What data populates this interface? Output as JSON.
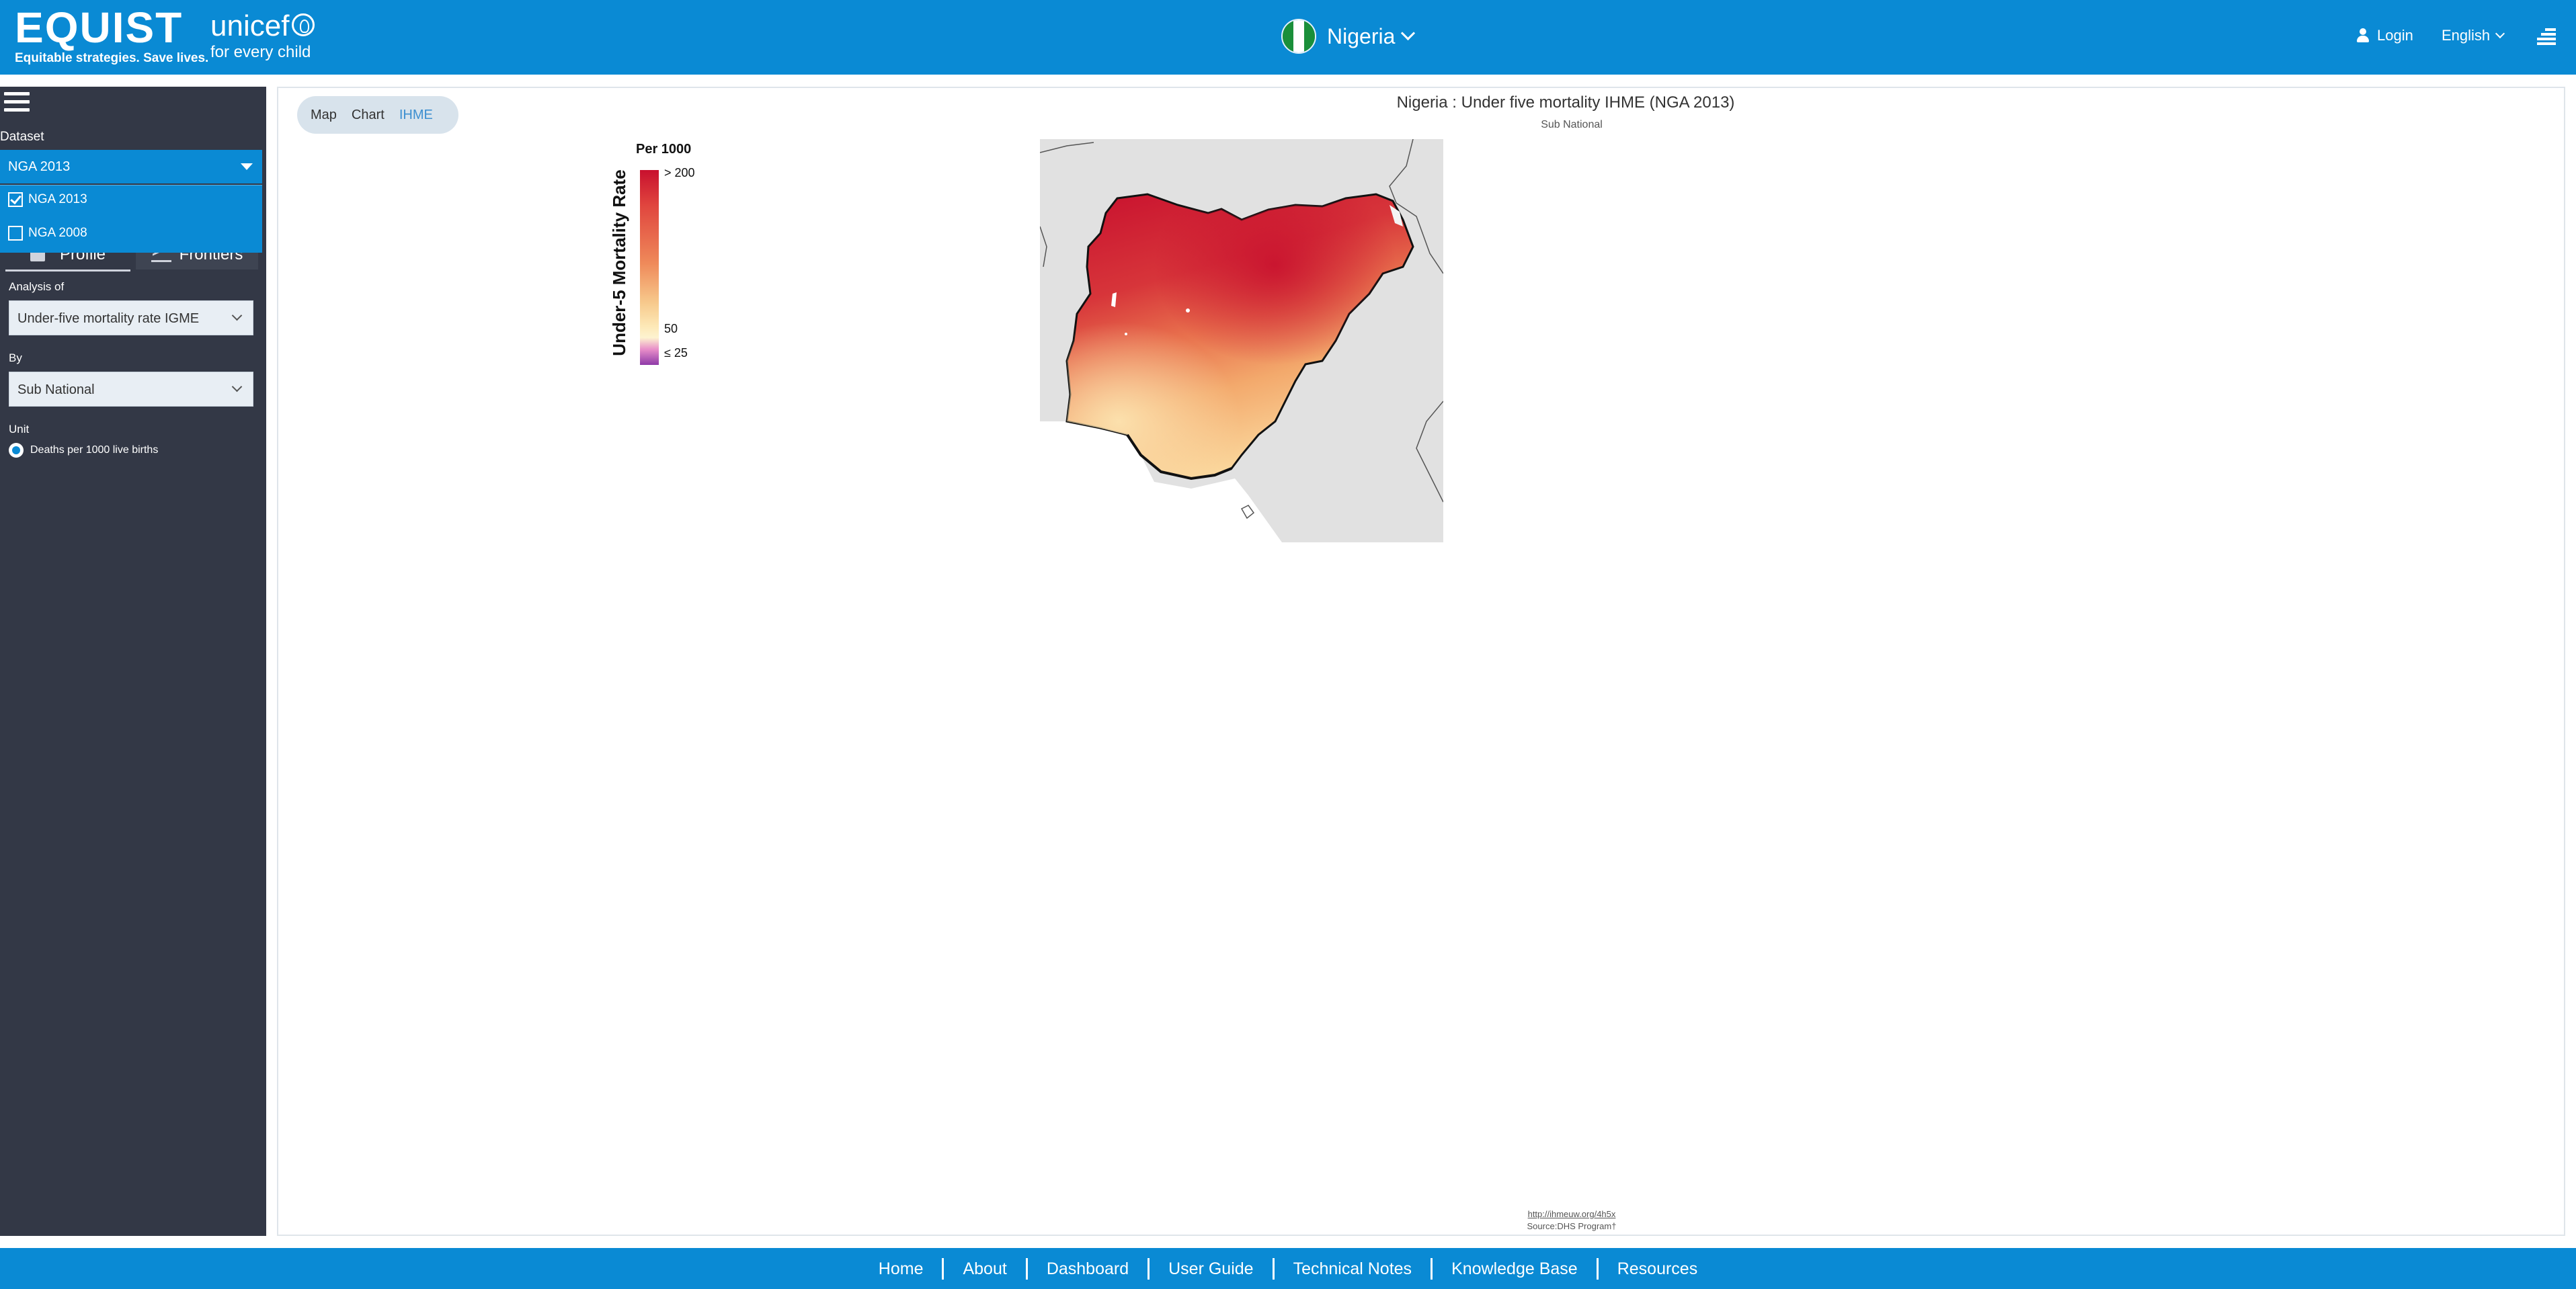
{
  "header": {
    "brand_name": "EQUIST",
    "brand_tagline": "Equitable strategies. Save lives.",
    "partner_name": "unicef",
    "partner_tagline": "for every child",
    "country": "Nigeria",
    "login_label": "Login",
    "language": "English"
  },
  "sidebar": {
    "dataset_label": "Dataset",
    "dataset_selected": "NGA 2013",
    "dataset_options": [
      {
        "label": "NGA 2013",
        "checked": true
      },
      {
        "label": "NGA 2008",
        "checked": false
      }
    ],
    "tabs": [
      "Profile",
      "Frontiers"
    ],
    "analysis_label": "Analysis of",
    "analysis_value": "Under-five mortality rate IGME",
    "by_label": "By",
    "by_value": "Sub National",
    "unit_label": "Unit",
    "unit_value": "Deaths per 1000 live births"
  },
  "main": {
    "view_tabs": [
      "Map",
      "Chart",
      "IHME"
    ],
    "active_view": "IHME",
    "title": "Nigeria : Under five mortality IHME (NGA 2013)",
    "subtitle": "Sub National",
    "legend": {
      "heading": "Per 1000",
      "axis_label": "Under-5 Mortality Rate",
      "top_label": "> 200",
      "mid_label": "50",
      "bottom_label": "≤ 25"
    },
    "source_link": "http://ihmeuw.org/4h5x",
    "source_text": "Source:DHS Program†"
  },
  "footer": {
    "links": [
      "Home",
      "About",
      "Dashboard",
      "User Guide",
      "Technical Notes",
      "Knowledge Base",
      "Resources"
    ]
  },
  "colors": {
    "header_blue": "#0a8ad4",
    "sidebar_dark": "#333846",
    "map_high": "#c8102e",
    "map_low": "#fde8b6",
    "map_background": "#e0e0e0"
  }
}
